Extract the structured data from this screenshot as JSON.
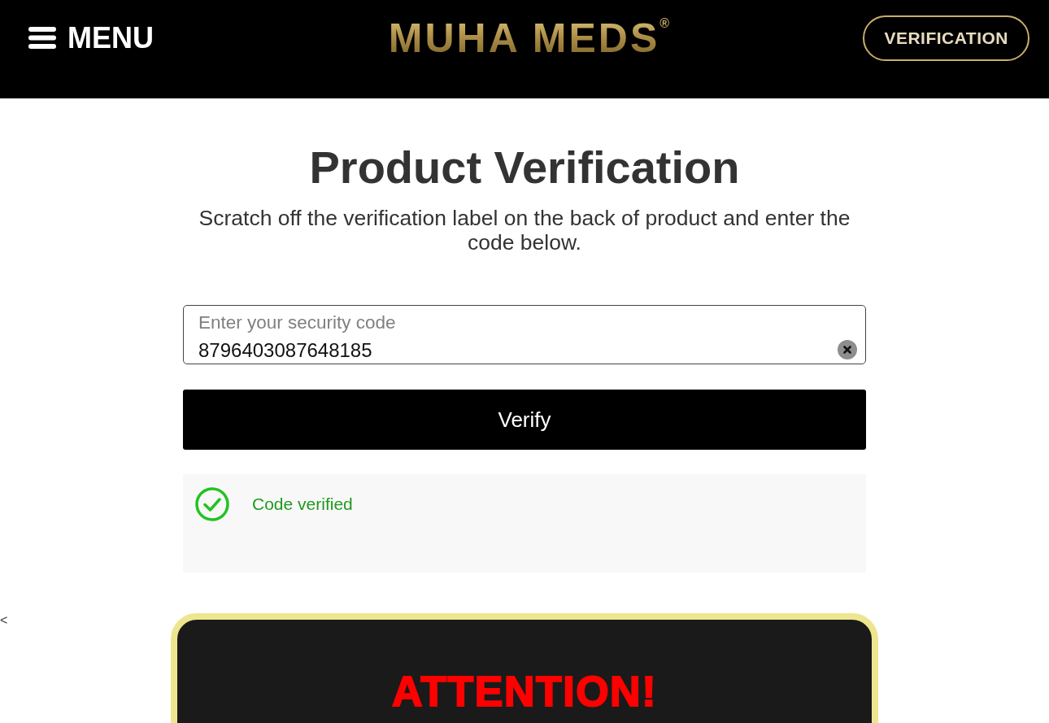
{
  "header": {
    "menu_label": "MENU",
    "logo": "MUHA MEDS$^{®}$",
    "verification_button": "VERIFICATION"
  },
  "verification": {
    "title": "Product Verification",
    "instructions": "Scratch off the verification label on the back of product and enter the code below.",
    "code_field": {
      "label": "Enter your security code",
      "value": "8796403087648185"
    },
    "verify_button": "Verify",
    "result": {
      "verified": true,
      "message": "Code verified"
    }
  },
  "side_arrow": "<",
  "notice": {
    "title": "ATTENTION!"
  }
}
